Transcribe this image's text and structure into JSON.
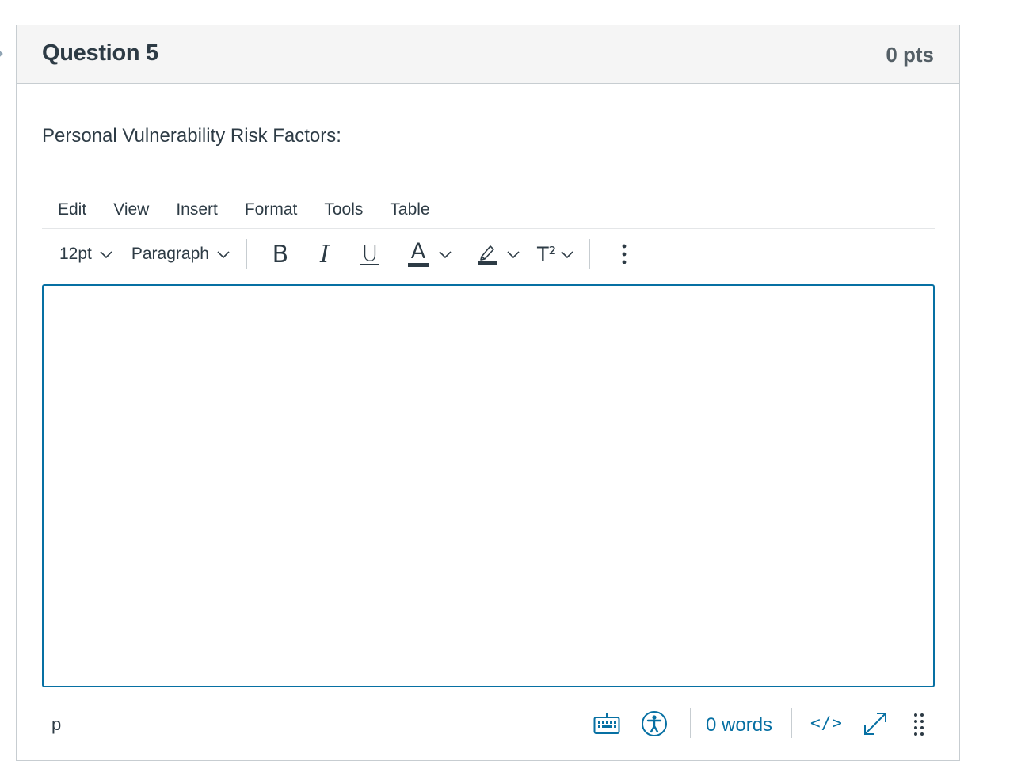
{
  "question": {
    "title": "Question 5",
    "points": "0 pts",
    "text": "Personal Vulnerability Risk Factors:"
  },
  "editor": {
    "menubar": [
      "Edit",
      "View",
      "Insert",
      "Format",
      "Tools",
      "Table"
    ],
    "toolbar": {
      "font_size": "12pt",
      "block_format": "Paragraph",
      "bold_label": "B",
      "italic_label": "I",
      "underline_label": "U",
      "text_color_label": "A",
      "superscript_label": "T²"
    },
    "content": "",
    "status": {
      "path": "p",
      "word_count": "0 words",
      "html_toggle": "</>"
    }
  },
  "colors": {
    "accent": "#0770a3",
    "text": "#2d3b45",
    "header_bg": "#f5f5f5",
    "border": "#c7cdd1"
  },
  "icons": {
    "flag": "flag-icon",
    "keyboard": "keyboard-icon",
    "accessibility": "accessibility-icon",
    "fullscreen": "fullscreen-icon",
    "resize": "resize-handle-icon",
    "more": "more-vertical-icon"
  }
}
